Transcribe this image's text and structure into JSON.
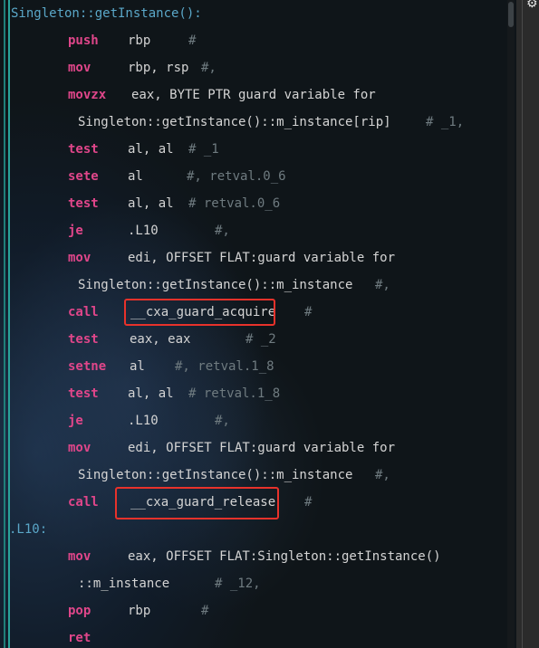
{
  "editor": {
    "func_label": "Singleton::getInstance():",
    "l10_label": ".L10:",
    "lines": [
      {
        "op": "push",
        "args": "rbp",
        "comment": "#"
      },
      {
        "op": "mov",
        "args": "rbp, rsp",
        "comment": "#,"
      },
      {
        "op": "movzx",
        "args": "eax, BYTE PTR guard variable for",
        "comment": ""
      },
      {
        "op": "",
        "args": "Singleton::getInstance()::m_instance[rip]",
        "comment": "# _1,"
      },
      {
        "op": "test",
        "args": "al, al",
        "comment": "# _1"
      },
      {
        "op": "sete",
        "args": "al",
        "comment": "#, retval.0_6"
      },
      {
        "op": "test",
        "args": "al, al",
        "comment": "# retval.0_6"
      },
      {
        "op": "je",
        "args": ".L10",
        "comment": "#,"
      },
      {
        "op": "mov",
        "args": "edi, OFFSET FLAT:guard variable for",
        "comment": ""
      },
      {
        "op": "",
        "args": "Singleton::getInstance()::m_instance",
        "comment": "#,"
      },
      {
        "op": "call",
        "args": "__cxa_guard_acquire",
        "comment": "#"
      },
      {
        "op": "test",
        "args": "eax, eax",
        "comment": "# _2"
      },
      {
        "op": "setne",
        "args": "al",
        "comment": "#, retval.1_8"
      },
      {
        "op": "test",
        "args": "al, al",
        "comment": "# retval.1_8"
      },
      {
        "op": "je",
        "args": ".L10",
        "comment": "#,"
      },
      {
        "op": "mov",
        "args": "edi, OFFSET FLAT:guard variable for",
        "comment": ""
      },
      {
        "op": "",
        "args": "Singleton::getInstance()::m_instance",
        "comment": "#,"
      },
      {
        "op": "call",
        "args": "__cxa_guard_release",
        "comment": "#"
      },
      {
        "op": "mov",
        "args": "eax, OFFSET FLAT:Singleton::getInstance()",
        "comment": ""
      },
      {
        "op": "",
        "args": "::m_instance",
        "comment": "# _12,"
      },
      {
        "op": "pop",
        "args": "rbp",
        "comment": "#"
      },
      {
        "op": "ret",
        "args": "",
        "comment": ""
      }
    ]
  },
  "side_panel": {
    "icon": "gear-icon",
    "glyph": "⚙"
  },
  "colors": {
    "keyword": "#e0468a",
    "highlight_box": "#e8322b",
    "label": "#5aa7c8",
    "comment": "#6f7b80"
  }
}
